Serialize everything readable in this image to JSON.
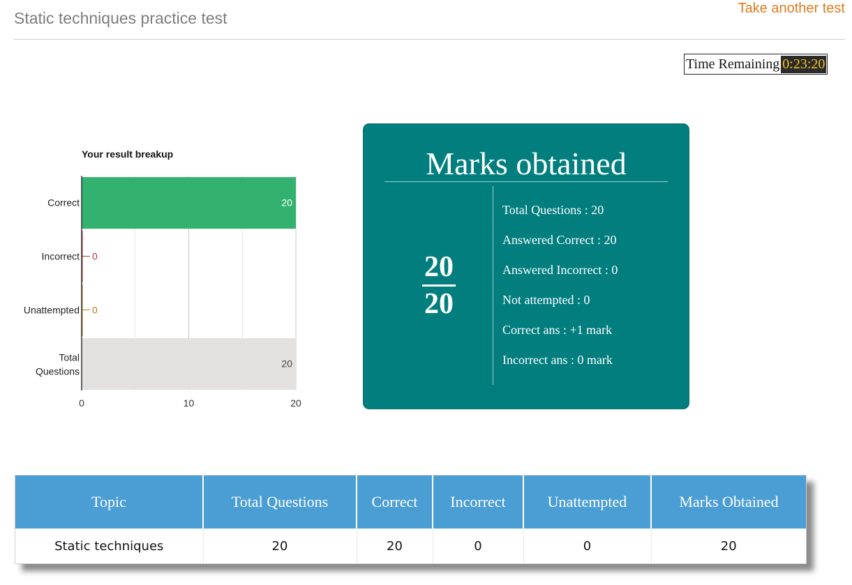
{
  "header": {
    "title": "Static techniques practice test",
    "take_another": "Take another test"
  },
  "timer": {
    "label": "Time Remaining",
    "value": "0:23:20"
  },
  "chart_data": {
    "type": "bar",
    "orientation": "horizontal",
    "title": "Your result breakup",
    "categories": [
      "Correct",
      "Incorrect",
      "Unattempted",
      "Total Questions"
    ],
    "values": [
      20,
      0,
      0,
      20
    ],
    "colors": [
      "#33b26f",
      "#b03a3a",
      "#b07d1a",
      "#e3e1df"
    ],
    "xlim": [
      0,
      20
    ],
    "xticks": [
      0,
      10,
      20
    ],
    "grid": true,
    "legend": "none"
  },
  "marks": {
    "title": "Marks obtained",
    "obtained": "20",
    "total": "20",
    "details": [
      "Total Questions : 20",
      "Answered Correct : 20",
      "Answered Incorrect : 0",
      "Not attempted : 0",
      "Correct ans : +1 mark",
      "Incorrect ans : 0 mark"
    ]
  },
  "table": {
    "headers": [
      "Topic",
      "Total Questions",
      "Correct",
      "Incorrect",
      "Unattempted",
      "Marks Obtained"
    ],
    "rows": [
      [
        "Static techniques",
        "20",
        "20",
        "0",
        "0",
        "20"
      ]
    ]
  },
  "colors": {
    "accent_orange": "#e07b1f",
    "card_teal": "#027e7e",
    "table_header": "#4b9ed4",
    "timer_digits": "#f6c21a"
  }
}
